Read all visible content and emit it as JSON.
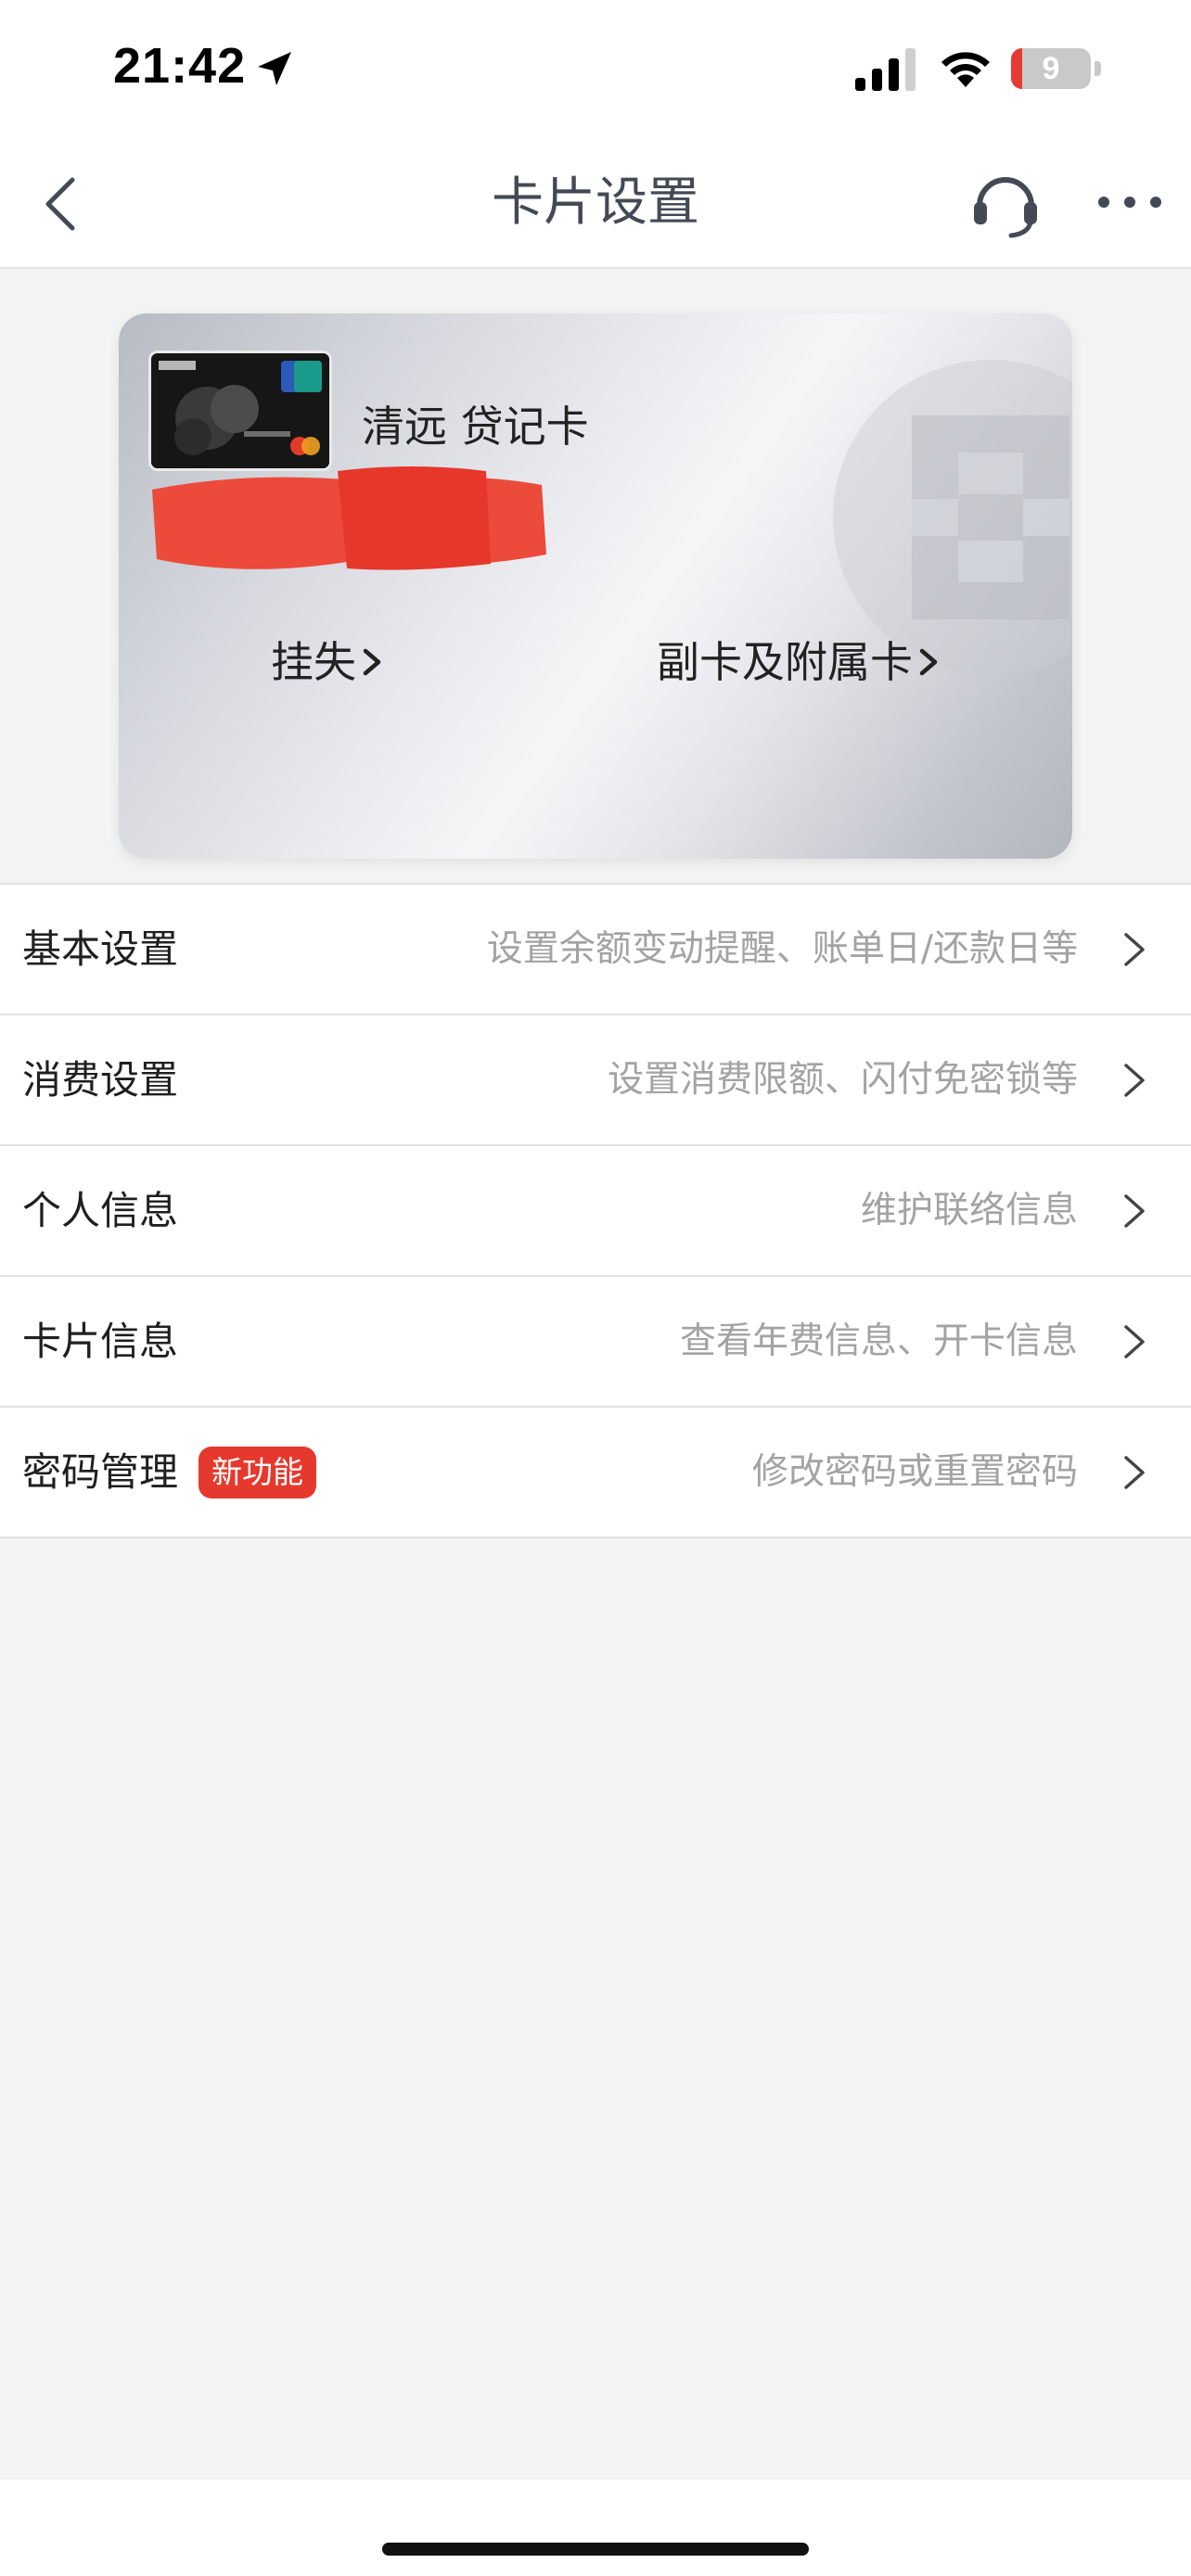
{
  "status_bar": {
    "time": "21:42",
    "battery_level": "9",
    "battery_fraction": 0.09,
    "icons": [
      "location-arrow-icon",
      "signal-icon",
      "wifi-icon",
      "battery-icon"
    ]
  },
  "nav": {
    "title": "卡片设置",
    "icons": [
      "chevron-left-icon",
      "headset-icon",
      "more-icon"
    ]
  },
  "card": {
    "name": "清远 贷记卡",
    "actions": [
      {
        "label": "挂失"
      },
      {
        "label": "副卡及附属卡"
      }
    ]
  },
  "settings": [
    {
      "title": "基本设置",
      "desc": "设置余额变动提醒、账单日/还款日等"
    },
    {
      "title": "消费设置",
      "desc": "设置消费限额、闪付免密锁等"
    },
    {
      "title": "个人信息",
      "desc": "维护联络信息"
    },
    {
      "title": "卡片信息",
      "desc": "查看年费信息、开卡信息"
    },
    {
      "title": "密码管理",
      "desc": "修改密码或重置密码",
      "badge": "新功能"
    }
  ],
  "colors": {
    "accent": "#e5392d",
    "title_text": "#444a55",
    "secondary_text": "#a3a3a3",
    "background": "#f3f3f3"
  }
}
